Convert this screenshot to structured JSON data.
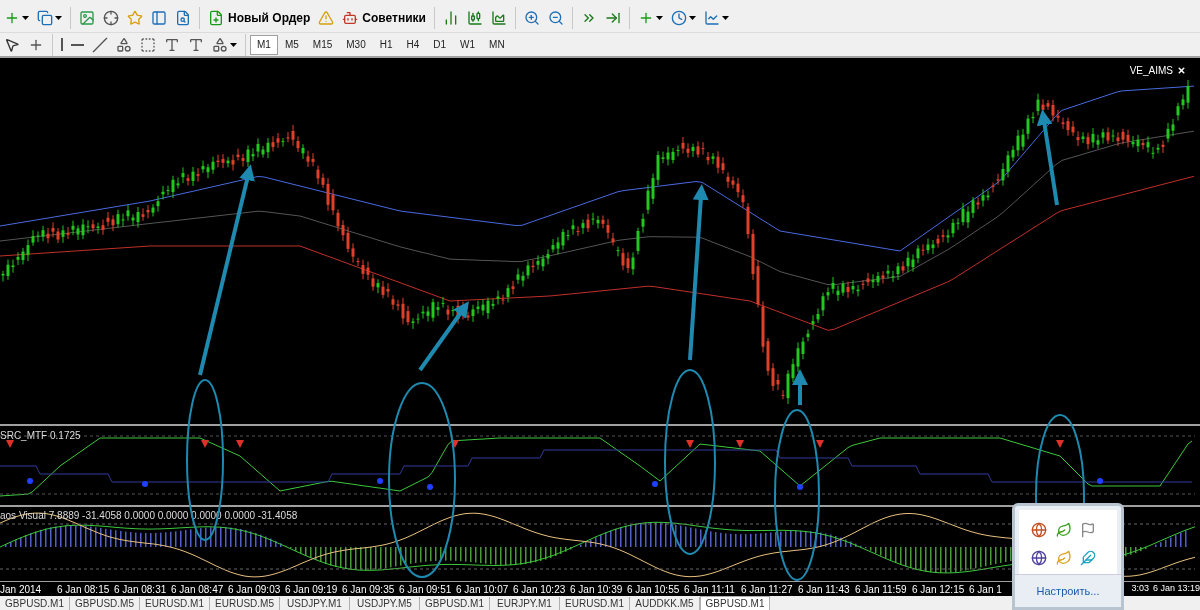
{
  "toolbar": {
    "buttons": [
      {
        "label": "Новый Ордер"
      },
      {
        "label": "Советники"
      }
    ]
  },
  "timeframes": [
    {
      "label": "M1",
      "selected": true
    },
    {
      "label": "M5",
      "selected": false
    },
    {
      "label": "M15",
      "selected": false
    },
    {
      "label": "M30",
      "selected": false
    },
    {
      "label": "H1",
      "selected": false
    },
    {
      "label": "H4",
      "selected": false
    },
    {
      "label": "D1",
      "selected": false
    },
    {
      "label": "W1",
      "selected": false
    },
    {
      "label": "MN",
      "selected": false
    }
  ],
  "chart": {
    "indicator": "VE_AIMS",
    "subwindows": [
      {
        "label": "SRC_MTF 0.1725"
      },
      {
        "label": "aos Visual 7.8889 -31.4058 0.0000 0.0000 0.0000 0.0000 -31.4058"
      }
    ],
    "time_axis": [
      "Jan 2014",
      "6 Jan 08:15",
      "6 Jan 08:31",
      "6 Jan 08:47",
      "6 Jan 09:03",
      "6 Jan 09:19",
      "6 Jan 09:35",
      "6 Jan 09:51",
      "6 Jan 10:07",
      "6 Jan 10:23",
      "6 Jan 10:39",
      "6 Jan 10:55",
      "6 Jan 11:11",
      "6 Jan 11:27",
      "6 Jan 11:43",
      "6 Jan 11:59",
      "6 Jan 12:15",
      "6 Jan 1"
    ],
    "time_axis_right": [
      "3:03",
      "6 Jan 13:19"
    ]
  },
  "tabs": [
    {
      "label": "GBPUSD.M1",
      "selected": false
    },
    {
      "label": "GBPUSD.M5",
      "selected": false
    },
    {
      "label": "EURUSD.M1",
      "selected": false
    },
    {
      "label": "EURUSD.M5",
      "selected": false
    },
    {
      "label": "USDJPY.M1",
      "selected": false
    },
    {
      "label": "USDJPY.M5",
      "selected": false
    },
    {
      "label": "GBPUSD.M1",
      "selected": false
    },
    {
      "label": "EURJPY.M1",
      "selected": false
    },
    {
      "label": "EURUSD.M1",
      "selected": false
    },
    {
      "label": "AUDDKK.M5",
      "selected": false
    },
    {
      "label": "GBPUSD.M1",
      "selected": true
    }
  ],
  "tray_popup": {
    "link": "Настроить..."
  }
}
